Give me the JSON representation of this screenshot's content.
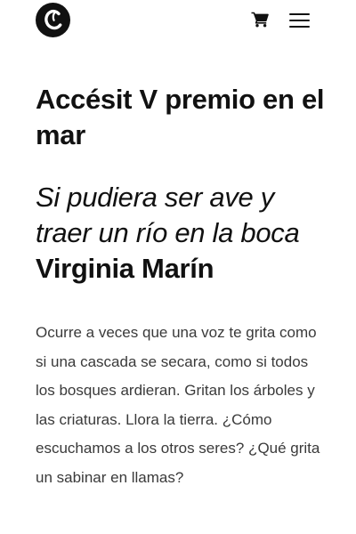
{
  "header": {
    "logo_icon": "c-logo-icon",
    "cart_icon": "cart-icon",
    "menu_icon": "hamburger-menu-icon"
  },
  "article": {
    "heading": "Accésit V premio en el mar",
    "poem_title": "Si pudiera ser ave y traer un río en la boca",
    "author": "Virginia Marín",
    "body": "Ocurre a veces que una voz te grita como si una cascada se secara, como si todos los bosques ardieran. Gritan los árboles y las criaturas. Llora la tierra. ¿Cómo escuchamos a los otros seres? ¿Qué grita un sabinar en llamas?"
  },
  "colors": {
    "text": "#111111",
    "body_text": "#3a3a3a",
    "background": "#ffffff"
  }
}
